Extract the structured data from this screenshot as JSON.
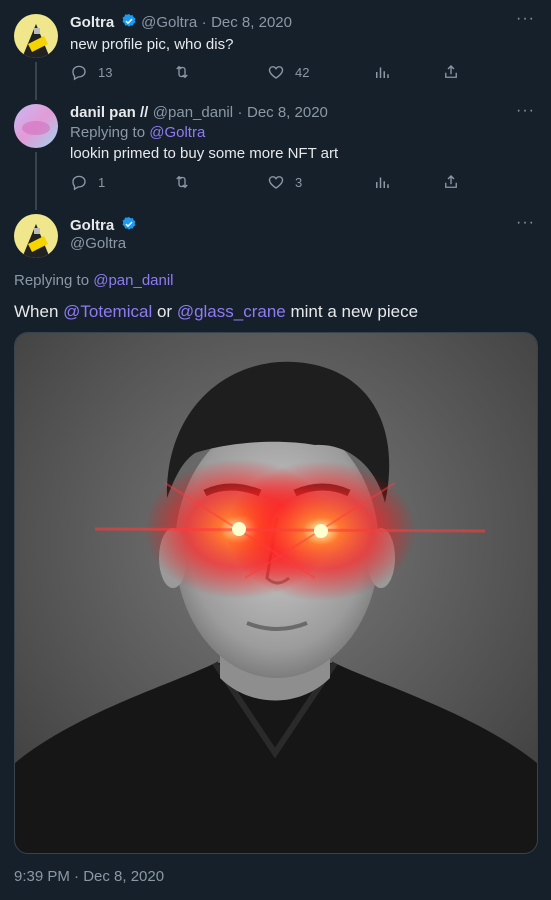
{
  "tweet1": {
    "name": "Goltra",
    "handle": "@Goltra",
    "sep": "·",
    "date": "Dec 8, 2020",
    "text": "new profile pic, who dis?",
    "replies": "13",
    "likes": "42"
  },
  "tweet2": {
    "name": "danil pan //",
    "handle": "@pan_danil",
    "sep": "·",
    "date": "Dec 8, 2020",
    "replying_prefix": "Replying to",
    "replying_handle": "@Goltra",
    "text": "lookin primed to buy some more NFT art",
    "replies": "1",
    "likes": "3"
  },
  "main": {
    "name": "Goltra",
    "handle": "@Goltra",
    "replying_prefix": "Replying to",
    "replying_handle": "@pan_danil",
    "text_1": "When",
    "mention_1": "@Totemical",
    "text_2": "or",
    "mention_2": "@glass_crane",
    "text_3": "mint a new piece",
    "timestamp": "9:39 PM · Dec 8, 2020"
  },
  "icons": [
    "reply-icon",
    "retweet-icon",
    "like-icon",
    "views-icon",
    "share-icon",
    "more-icon",
    "verified-badge-icon"
  ],
  "colors": {
    "background": "#15202b",
    "accent": "#1d9bf0",
    "muted": "#8b98a5",
    "mention": "#8f7bf3"
  }
}
